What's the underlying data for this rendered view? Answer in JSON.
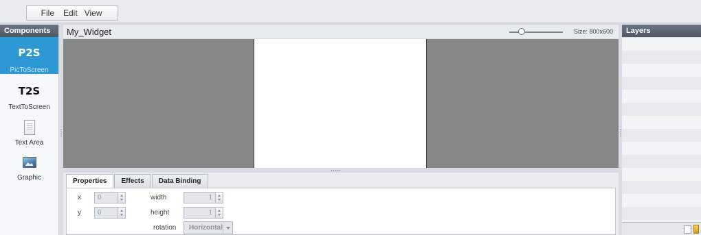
{
  "menubar": {
    "items": [
      "File",
      "Edit",
      "View"
    ]
  },
  "components_panel": {
    "header": "Components",
    "items": [
      {
        "big": "P2S",
        "label": "PicToScreen",
        "selected": true
      },
      {
        "big": "T2S",
        "label": "TextToScreen",
        "selected": false
      },
      {
        "icon": "text-area-icon",
        "label": "Text Area",
        "selected": false
      },
      {
        "icon": "graphic-icon",
        "label": "Graphic",
        "selected": false
      }
    ]
  },
  "editor": {
    "title": "My_Widget",
    "size_label": "Size: 800x600",
    "zoom_level": 0.25
  },
  "properties_panel": {
    "tabs": [
      "Properties",
      "Effects",
      "Data Binding"
    ],
    "active_tab": "Properties",
    "fields": {
      "x": {
        "label": "x",
        "value": "0"
      },
      "y": {
        "label": "y",
        "value": "0"
      },
      "width": {
        "label": "width",
        "value": "1"
      },
      "height": {
        "label": "height",
        "value": "1"
      },
      "rotation": {
        "label": "rotation",
        "value": "Horizontal"
      }
    }
  },
  "layers_panel": {
    "header": "Layers"
  },
  "colors": {
    "accent": "#2e98d4",
    "panel_header": "#5b6472",
    "stage": "#878787"
  }
}
